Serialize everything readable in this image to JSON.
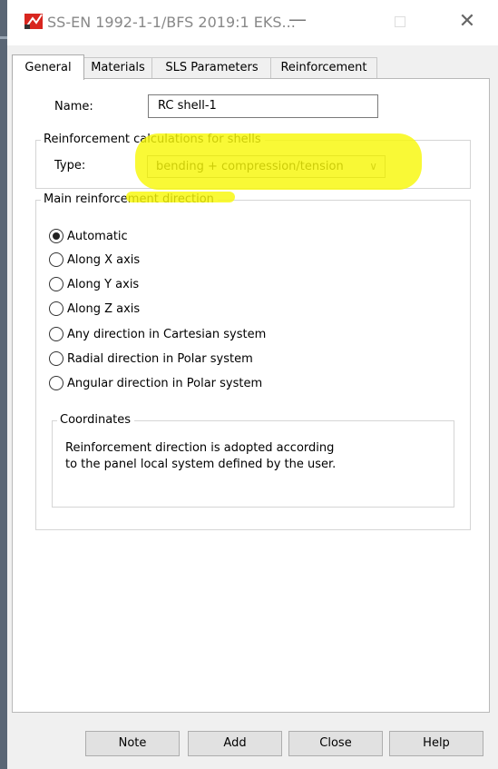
{
  "window": {
    "title": "SS-EN 1992-1-1/BFS 2019:1 EKS...",
    "minimize_symbol": "—",
    "close_symbol": "✕"
  },
  "tabs": [
    {
      "label": "General",
      "active": true
    },
    {
      "label": "Materials",
      "active": false
    },
    {
      "label": "SLS Parameters",
      "active": false
    },
    {
      "label": "Reinforcement",
      "active": false
    }
  ],
  "general": {
    "name_label": "Name:",
    "name_value": "RC shell-1",
    "calc_group_title": "Reinforcement calculations for shells",
    "type_label": "Type:",
    "type_value": "bending + compression/tension",
    "direction_group_title": "Main reinforcement direction",
    "direction_options": [
      {
        "label": "Automatic",
        "checked": true
      },
      {
        "label": "Along X axis",
        "checked": false
      },
      {
        "label": "Along Y axis",
        "checked": false
      },
      {
        "label": "Along Z axis",
        "checked": false
      },
      {
        "label": "Any direction in Cartesian system",
        "checked": false
      },
      {
        "label": "Radial direction in Polar system",
        "checked": false
      },
      {
        "label": "Angular direction in Polar system",
        "checked": false
      }
    ],
    "coordinates_title": "Coordinates",
    "coordinates_text_line1": "Reinforcement direction is adopted according",
    "coordinates_text_line2": "to the panel local system defined by the user."
  },
  "buttons": {
    "note": "Note",
    "add": "Add",
    "close": "Close",
    "help": "Help"
  },
  "colors": {
    "highlight": "#f8f80a",
    "panel_bg": "#ffffff",
    "dialog_bg": "#f0f0f0"
  }
}
